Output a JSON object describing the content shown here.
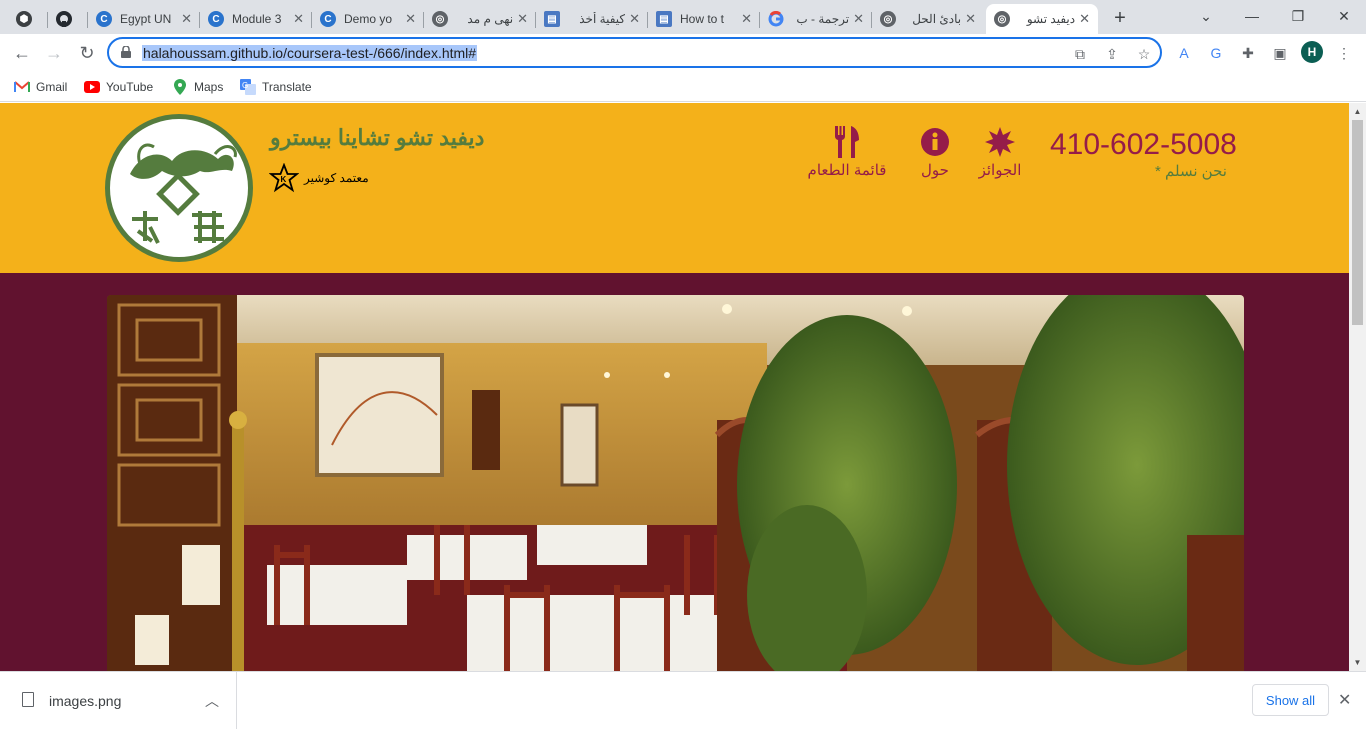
{
  "browser": {
    "tabs": [
      {
        "title": "",
        "favicon": "chrome-icon"
      },
      {
        "title": "",
        "favicon": "github-icon"
      },
      {
        "title": "Egypt UN",
        "favicon": "coursera-icon"
      },
      {
        "title": "Module 3",
        "favicon": "coursera-icon"
      },
      {
        "title": "Demo yo",
        "favicon": "coursera-icon"
      },
      {
        "title": "نهى م مد",
        "favicon": "globe-icon"
      },
      {
        "title": "كيفية أخذ",
        "favicon": "doc-icon"
      },
      {
        "title": "How to t",
        "favicon": "doc-icon"
      },
      {
        "title": "ترجمة - ب",
        "favicon": "google-icon"
      },
      {
        "title": "بادئ الحل",
        "favicon": "globe-icon"
      },
      {
        "title": "ديفيد تشو",
        "favicon": "globe-icon"
      }
    ],
    "new_tab_label": "+",
    "url": "halahoussam.github.io/coursera-test-/666/index.html#",
    "profile_initial": "H",
    "bookmarks": [
      {
        "label": "Gmail",
        "icon": "gmail-icon"
      },
      {
        "label": "YouTube",
        "icon": "youtube-icon"
      },
      {
        "label": "Maps",
        "icon": "maps-icon"
      },
      {
        "label": "Translate",
        "icon": "translate-icon"
      }
    ]
  },
  "page": {
    "brand_title": "ديفيد تشو تشاينا بيسترو",
    "kosher_label": "معتمد كوشير",
    "nav": [
      {
        "label": "قائمة الطعام",
        "icon": "cutlery-icon"
      },
      {
        "label": "حول",
        "icon": "info-icon"
      },
      {
        "label": "الجوائز",
        "icon": "certificate-icon"
      }
    ],
    "phone": "410-602-5008",
    "delivery": "نحن نسلم *",
    "colors": {
      "header_bg": "#f4b11a",
      "body_bg": "#61122f",
      "accent": "#951c49",
      "green": "#557c3e"
    }
  },
  "downloads": {
    "file_name": "images.png",
    "show_all_label": "Show all"
  }
}
